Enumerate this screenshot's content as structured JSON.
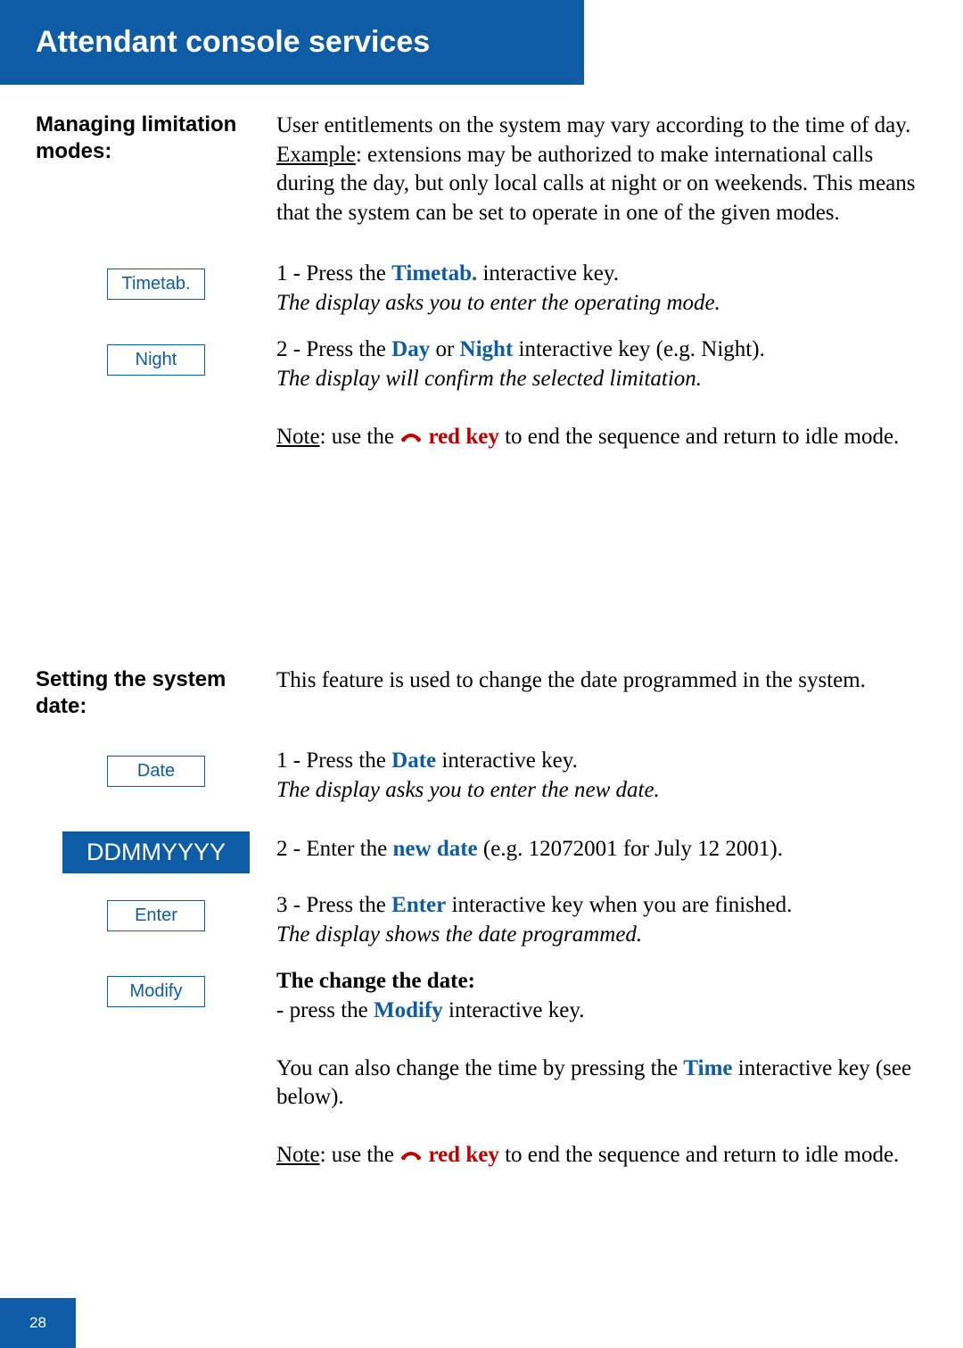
{
  "header": {
    "title": "Attendant console services"
  },
  "section1": {
    "heading": "Managing limitation modes:",
    "intro_p1": "User entitlements on the system may vary according to the time of day.",
    "example_label": "Example",
    "example_rest": ": extensions may be authorized to make international calls during the day, but only local calls at night or on weekends. This means that the system can be set to operate in one of the given modes.",
    "btn_timetab": "Timetab.",
    "step1_pre": "1 - Press the ",
    "step1_key": "Timetab.",
    "step1_post": " interactive key.",
    "step1_ital": "The display asks you to enter the operating mode.",
    "btn_night": "Night",
    "step2_pre": "2 - Press the ",
    "step2_day": "Day",
    "step2_or": " or ",
    "step2_night": "Night",
    "step2_post": " interactive key (e.g. Night).",
    "step2_ital": "The display will confirm the selected limitation.",
    "note_label": "Note",
    "note_mid1": ": use the ",
    "note_red": " red key",
    "note_end": " to end the sequence and return to idle mode."
  },
  "section2": {
    "heading": "Setting the system date:",
    "intro": "This feature is used to change the date programmed in the system.",
    "btn_date": "Date",
    "step1_pre": "1 - Press the ",
    "step1_key": "Date",
    "step1_post": " interactive key.",
    "step1_ital": "The display asks you to enter the new date.",
    "display_text": "DDMMYYYY",
    "step2_pre": "2 - Enter the ",
    "step2_key": "new date",
    "step2_post": " (e.g. 12072001 for July 12 2001).",
    "btn_enter": "Enter",
    "step3_pre": "3 - Press the ",
    "step3_key": "Enter",
    "step3_post": " interactive key when you are finished.",
    "step3_ital": "The display shows the date programmed.",
    "btn_modify": "Modify",
    "change_heading": "The change the date:",
    "change_pre": "- press the ",
    "change_key": "Modify",
    "change_post": " interactive key.",
    "time_pre": "You can also change the time by pressing the ",
    "time_key": "Time",
    "time_post": " interactive key (see below).",
    "note_label": "Note",
    "note_mid1": ": use the ",
    "note_red": " red key",
    "note_end": " to end the sequence and return to idle mode."
  },
  "footer": {
    "page": "28"
  }
}
